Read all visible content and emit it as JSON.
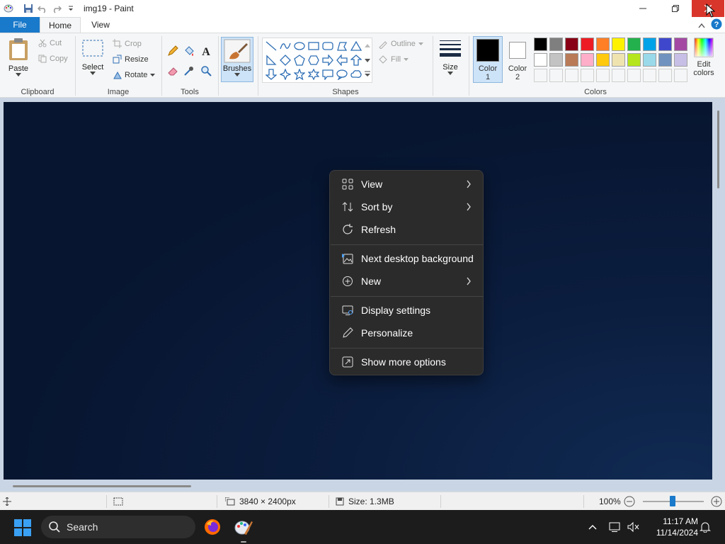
{
  "window": {
    "title": "img19 - Paint"
  },
  "tabs": {
    "file": "File",
    "home": "Home",
    "view": "View"
  },
  "ribbon": {
    "clipboard": {
      "label": "Clipboard",
      "paste": "Paste",
      "cut": "Cut",
      "copy": "Copy"
    },
    "image": {
      "label": "Image",
      "select": "Select",
      "crop": "Crop",
      "resize": "Resize",
      "rotate": "Rotate"
    },
    "tools": {
      "label": "Tools"
    },
    "brushes": {
      "label": "Brushes"
    },
    "shapes": {
      "label": "Shapes",
      "outline": "Outline",
      "fill": "Fill"
    },
    "size": {
      "label": "Size"
    },
    "colors": {
      "label": "Colors",
      "color1_label": "Color",
      "color1_num": "1",
      "color2_label": "Color",
      "color2_num": "2",
      "edit_label1": "Edit",
      "edit_label2": "colors",
      "color1": "#000000",
      "color2": "#ffffff",
      "palette_row1": [
        "#000000",
        "#7f7f7f",
        "#880015",
        "#ed1c24",
        "#ff7f27",
        "#fff200",
        "#22b14c",
        "#00a2e8",
        "#3f48cc",
        "#a349a4"
      ],
      "palette_row2": [
        "#ffffff",
        "#c3c3c3",
        "#b97a57",
        "#ffaec9",
        "#ffc90e",
        "#efe4b0",
        "#b5e61d",
        "#99d9ea",
        "#7092be",
        "#c8bfe7"
      ]
    }
  },
  "context_menu": {
    "items": [
      {
        "label": "View",
        "icon": "grid-icon",
        "submenu": true
      },
      {
        "label": "Sort by",
        "icon": "sort-icon",
        "submenu": true
      },
      {
        "label": "Refresh",
        "icon": "refresh-icon",
        "submenu": false
      },
      {
        "label": "Next desktop background",
        "icon": "picture-icon",
        "submenu": false
      },
      {
        "label": "New",
        "icon": "plus-circle-icon",
        "submenu": true
      },
      {
        "label": "Display settings",
        "icon": "display-icon",
        "submenu": false
      },
      {
        "label": "Personalize",
        "icon": "pen-icon",
        "submenu": false
      },
      {
        "label": "Show more options",
        "icon": "expand-icon",
        "submenu": false
      }
    ]
  },
  "statusbar": {
    "dimensions": "3840 × 2400px",
    "size": "Size: 1.3MB",
    "zoom": "100%"
  },
  "taskbar": {
    "search_placeholder": "Search",
    "time": "11:17 AM",
    "date": "11/14/2024"
  }
}
